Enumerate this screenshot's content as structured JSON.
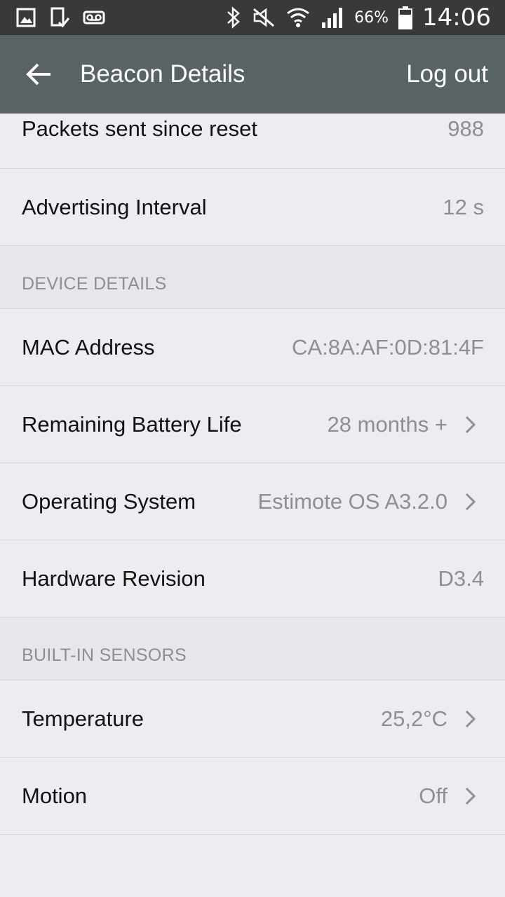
{
  "status_bar": {
    "battery_percent": "66%",
    "time": "14:06",
    "icons": [
      "gallery-icon",
      "download-done-icon",
      "voicemail-icon",
      "bluetooth-icon",
      "mute-icon",
      "wifi-icon",
      "signal-icon",
      "battery-icon"
    ]
  },
  "app_bar": {
    "title": "Beacon Details",
    "logout_label": "Log out",
    "background": "#596366"
  },
  "rows_top": [
    {
      "label": "Packets sent since reset",
      "value": "988"
    },
    {
      "label": "Advertising Interval",
      "value": "12 s"
    }
  ],
  "device_details": {
    "title": "DEVICE DETAILS",
    "rows": [
      {
        "label": "MAC Address",
        "value": "CA:8A:AF:0D:81:4F"
      },
      {
        "label": "Remaining Battery Life",
        "value": "28 months +"
      },
      {
        "label": "Operating System",
        "value": "Estimote OS A3.2.0"
      },
      {
        "label": "Hardware Revision",
        "value": "D3.4"
      }
    ]
  },
  "built_in_sensors": {
    "title": "BUILT-IN SENSORS",
    "rows": [
      {
        "label": "Temperature",
        "value": "25,2°C"
      },
      {
        "label": "Motion",
        "value": "Off"
      }
    ]
  }
}
